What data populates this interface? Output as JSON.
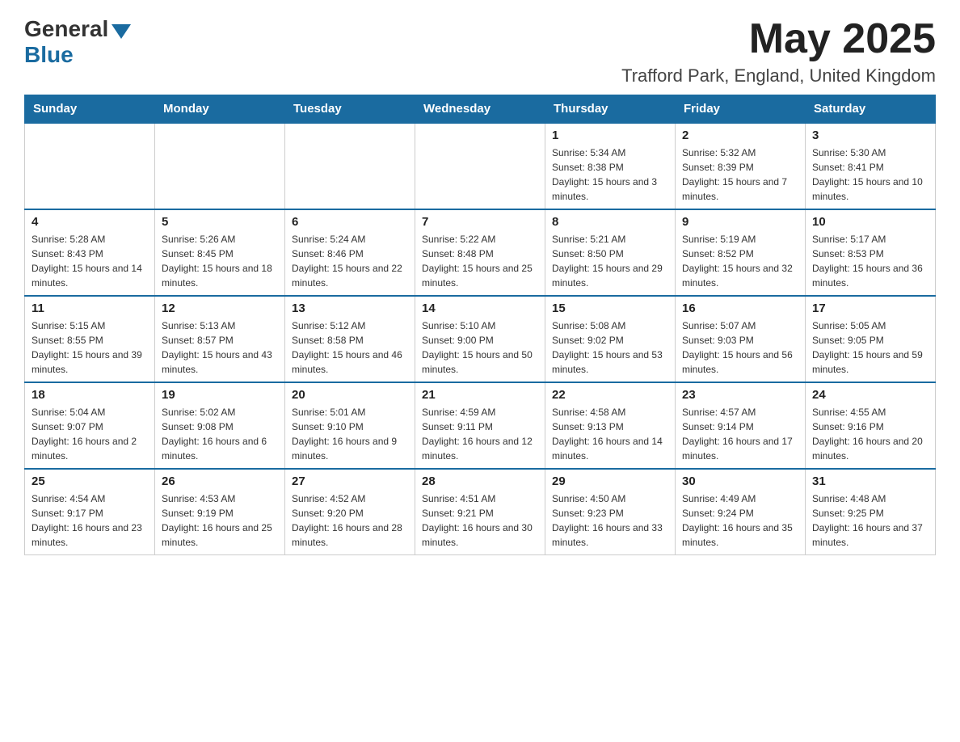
{
  "header": {
    "logo_general": "General",
    "logo_blue": "Blue",
    "month_year": "May 2025",
    "location": "Trafford Park, England, United Kingdom"
  },
  "days_of_week": [
    "Sunday",
    "Monday",
    "Tuesday",
    "Wednesday",
    "Thursday",
    "Friday",
    "Saturday"
  ],
  "weeks": [
    [
      {
        "day": "",
        "info": ""
      },
      {
        "day": "",
        "info": ""
      },
      {
        "day": "",
        "info": ""
      },
      {
        "day": "",
        "info": ""
      },
      {
        "day": "1",
        "info": "Sunrise: 5:34 AM\nSunset: 8:38 PM\nDaylight: 15 hours and 3 minutes."
      },
      {
        "day": "2",
        "info": "Sunrise: 5:32 AM\nSunset: 8:39 PM\nDaylight: 15 hours and 7 minutes."
      },
      {
        "day": "3",
        "info": "Sunrise: 5:30 AM\nSunset: 8:41 PM\nDaylight: 15 hours and 10 minutes."
      }
    ],
    [
      {
        "day": "4",
        "info": "Sunrise: 5:28 AM\nSunset: 8:43 PM\nDaylight: 15 hours and 14 minutes."
      },
      {
        "day": "5",
        "info": "Sunrise: 5:26 AM\nSunset: 8:45 PM\nDaylight: 15 hours and 18 minutes."
      },
      {
        "day": "6",
        "info": "Sunrise: 5:24 AM\nSunset: 8:46 PM\nDaylight: 15 hours and 22 minutes."
      },
      {
        "day": "7",
        "info": "Sunrise: 5:22 AM\nSunset: 8:48 PM\nDaylight: 15 hours and 25 minutes."
      },
      {
        "day": "8",
        "info": "Sunrise: 5:21 AM\nSunset: 8:50 PM\nDaylight: 15 hours and 29 minutes."
      },
      {
        "day": "9",
        "info": "Sunrise: 5:19 AM\nSunset: 8:52 PM\nDaylight: 15 hours and 32 minutes."
      },
      {
        "day": "10",
        "info": "Sunrise: 5:17 AM\nSunset: 8:53 PM\nDaylight: 15 hours and 36 minutes."
      }
    ],
    [
      {
        "day": "11",
        "info": "Sunrise: 5:15 AM\nSunset: 8:55 PM\nDaylight: 15 hours and 39 minutes."
      },
      {
        "day": "12",
        "info": "Sunrise: 5:13 AM\nSunset: 8:57 PM\nDaylight: 15 hours and 43 minutes."
      },
      {
        "day": "13",
        "info": "Sunrise: 5:12 AM\nSunset: 8:58 PM\nDaylight: 15 hours and 46 minutes."
      },
      {
        "day": "14",
        "info": "Sunrise: 5:10 AM\nSunset: 9:00 PM\nDaylight: 15 hours and 50 minutes."
      },
      {
        "day": "15",
        "info": "Sunrise: 5:08 AM\nSunset: 9:02 PM\nDaylight: 15 hours and 53 minutes."
      },
      {
        "day": "16",
        "info": "Sunrise: 5:07 AM\nSunset: 9:03 PM\nDaylight: 15 hours and 56 minutes."
      },
      {
        "day": "17",
        "info": "Sunrise: 5:05 AM\nSunset: 9:05 PM\nDaylight: 15 hours and 59 minutes."
      }
    ],
    [
      {
        "day": "18",
        "info": "Sunrise: 5:04 AM\nSunset: 9:07 PM\nDaylight: 16 hours and 2 minutes."
      },
      {
        "day": "19",
        "info": "Sunrise: 5:02 AM\nSunset: 9:08 PM\nDaylight: 16 hours and 6 minutes."
      },
      {
        "day": "20",
        "info": "Sunrise: 5:01 AM\nSunset: 9:10 PM\nDaylight: 16 hours and 9 minutes."
      },
      {
        "day": "21",
        "info": "Sunrise: 4:59 AM\nSunset: 9:11 PM\nDaylight: 16 hours and 12 minutes."
      },
      {
        "day": "22",
        "info": "Sunrise: 4:58 AM\nSunset: 9:13 PM\nDaylight: 16 hours and 14 minutes."
      },
      {
        "day": "23",
        "info": "Sunrise: 4:57 AM\nSunset: 9:14 PM\nDaylight: 16 hours and 17 minutes."
      },
      {
        "day": "24",
        "info": "Sunrise: 4:55 AM\nSunset: 9:16 PM\nDaylight: 16 hours and 20 minutes."
      }
    ],
    [
      {
        "day": "25",
        "info": "Sunrise: 4:54 AM\nSunset: 9:17 PM\nDaylight: 16 hours and 23 minutes."
      },
      {
        "day": "26",
        "info": "Sunrise: 4:53 AM\nSunset: 9:19 PM\nDaylight: 16 hours and 25 minutes."
      },
      {
        "day": "27",
        "info": "Sunrise: 4:52 AM\nSunset: 9:20 PM\nDaylight: 16 hours and 28 minutes."
      },
      {
        "day": "28",
        "info": "Sunrise: 4:51 AM\nSunset: 9:21 PM\nDaylight: 16 hours and 30 minutes."
      },
      {
        "day": "29",
        "info": "Sunrise: 4:50 AM\nSunset: 9:23 PM\nDaylight: 16 hours and 33 minutes."
      },
      {
        "day": "30",
        "info": "Sunrise: 4:49 AM\nSunset: 9:24 PM\nDaylight: 16 hours and 35 minutes."
      },
      {
        "day": "31",
        "info": "Sunrise: 4:48 AM\nSunset: 9:25 PM\nDaylight: 16 hours and 37 minutes."
      }
    ]
  ]
}
